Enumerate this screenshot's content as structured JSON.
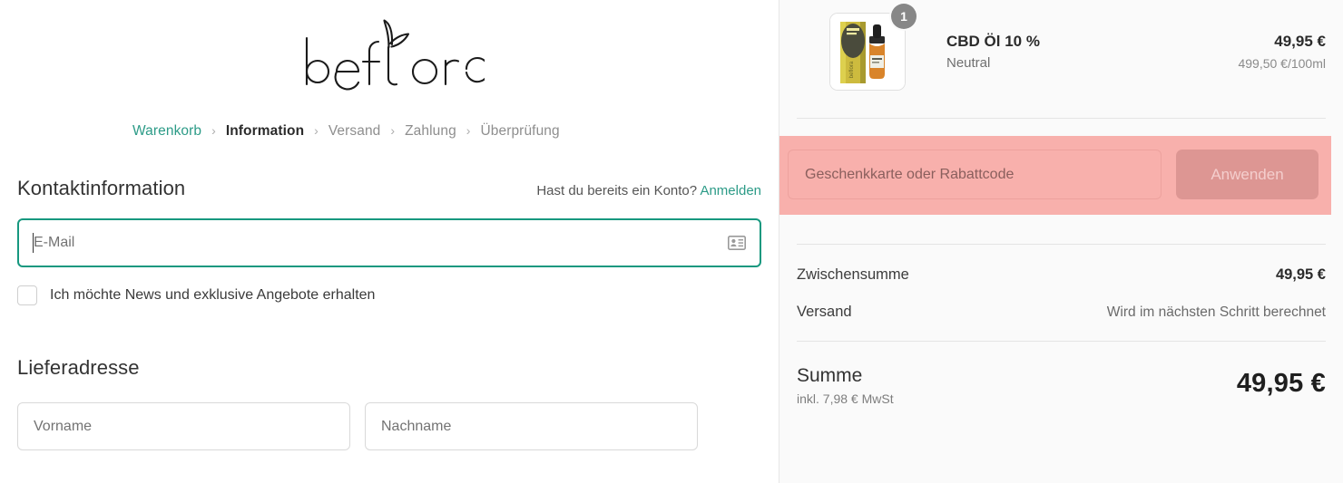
{
  "brand": {
    "logo_text": "beflora",
    "logo_icon": "sprout-leaf-icon"
  },
  "breadcrumb": {
    "separator": "›",
    "items": [
      {
        "label": "Warenkorb",
        "state": "link"
      },
      {
        "label": "Information",
        "state": "current"
      },
      {
        "label": "Versand",
        "state": "upcoming"
      },
      {
        "label": "Zahlung",
        "state": "upcoming"
      },
      {
        "label": "Überprüfung",
        "state": "upcoming"
      }
    ]
  },
  "contact": {
    "title": "Kontaktinformation",
    "account_question": "Hast du bereits ein Konto?",
    "login_link": "Anmelden",
    "email_placeholder": "E-Mail",
    "email_value": "",
    "autofill_icon": "contact-card-icon",
    "newsletter_label": "Ich möchte News und exklusive Angebote erhalten",
    "newsletter_checked": false
  },
  "shipping": {
    "title": "Lieferadresse",
    "first_name_placeholder": "Vorname",
    "first_name_value": "",
    "last_name_placeholder": "Nachname",
    "last_name_value": ""
  },
  "summary": {
    "line_item": {
      "title": "CBD Öl 10 %",
      "variant": "Neutral",
      "quantity": "1",
      "price": "49,95 €",
      "unit_price": "499,50 €/100ml",
      "thumbnail_alt": "cbd-oil-product-thumbnail"
    },
    "discount": {
      "placeholder": "Geschenkkarte oder Rabattcode",
      "value": "",
      "apply_label": "Anwenden",
      "highlight_color": "#f8b0ac",
      "button_color": "#dd9693"
    },
    "totals": [
      {
        "label": "Zwischensumme",
        "value": "49,95 €",
        "muted": false
      },
      {
        "label": "Versand",
        "value": "Wird im nächsten Schritt berechnet",
        "muted": true
      }
    ],
    "grand_total": {
      "label": "Summe",
      "tax_note": "inkl. 7,98 € MwSt",
      "value": "49,95 €"
    }
  },
  "colors": {
    "accent_teal": "#2c9b87",
    "focus_teal": "#17987f",
    "sidebar_bg": "#fafafa",
    "highlight_pink": "#f8b0ac"
  }
}
